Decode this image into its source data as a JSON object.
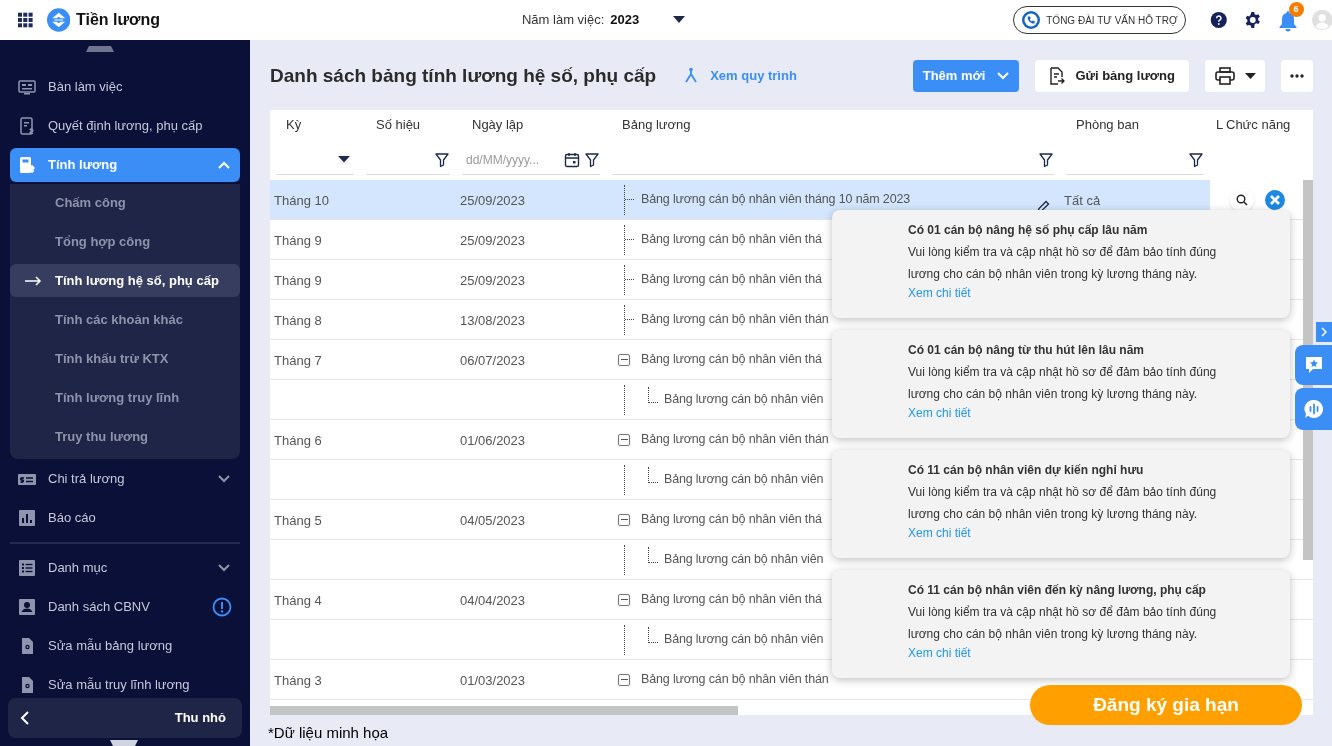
{
  "app": {
    "title": "Tiền lương"
  },
  "working_year": {
    "label": "Năm làm việc:",
    "value": "2023"
  },
  "support": {
    "label": "TỔNG ĐÀI TƯ VẤN HỖ TRỢ"
  },
  "notifications": {
    "count": "6"
  },
  "sidebar": {
    "sections": [
      {
        "items": [
          {
            "label": "Bàn làm việc",
            "selected": false
          },
          {
            "label": "Quyết định lương, phụ cấp",
            "selected": false
          },
          {
            "label": "Tính lương",
            "selected": true,
            "expanded": true,
            "children": [
              {
                "label": "Chấm công",
                "selected": false
              },
              {
                "label": "Tổng hợp công",
                "selected": false
              },
              {
                "label": "Tính lương hệ số, phụ cấp",
                "selected": true
              },
              {
                "label": "Tính các khoản khác",
                "selected": false
              },
              {
                "label": "Tính khấu trừ KTX",
                "selected": false
              },
              {
                "label": "Tính lương truy lĩnh",
                "selected": false
              },
              {
                "label": "Truy thu lương",
                "selected": false
              }
            ]
          },
          {
            "label": "Chi trả lương",
            "selected": false,
            "expanded": false
          },
          {
            "label": "Báo cáo",
            "selected": false
          }
        ]
      },
      {
        "items": [
          {
            "label": "Danh mục",
            "selected": false,
            "expanded": false
          },
          {
            "label": "Danh sách CBNV",
            "selected": false,
            "warning": true
          },
          {
            "label": "Sửa mẫu bảng lương",
            "selected": false
          },
          {
            "label": "Sửa mẫu truy lĩnh lương",
            "selected": false
          }
        ]
      }
    ],
    "collapse_label": "Thu nhỏ"
  },
  "page": {
    "title": "Danh sách bảng tính lương hệ số, phụ cấp",
    "process_link": "Xem quy trình",
    "add_button": "Thêm mới",
    "send_button": "Gửi bảng lương"
  },
  "table": {
    "columns": [
      {
        "label": "Kỳ",
        "kind": "dropdown"
      },
      {
        "label": "Số hiệu",
        "kind": "text"
      },
      {
        "label": "Ngày lập",
        "kind": "date",
        "placeholder": "dd/MM/yyyy..."
      },
      {
        "label": "Bảng lương",
        "kind": "text"
      },
      {
        "label": "Phòng ban",
        "kind": "text"
      },
      {
        "label": "L",
        "kind": "plain"
      },
      {
        "label": "Chức năng",
        "kind": "plain"
      }
    ],
    "rows": [
      {
        "kind": "leaf",
        "selected": true,
        "period": "Tháng 10",
        "date": "25/09/2023",
        "name": "Bảng lương cán bộ nhân viên tháng 10 năm 2023",
        "department": "Tất cả"
      },
      {
        "kind": "leaf",
        "selected": false,
        "period": "Tháng 9",
        "date": "25/09/2023",
        "name": "Bảng lương cán bộ nhân viên thá"
      },
      {
        "kind": "leaf",
        "selected": false,
        "period": "Tháng 9",
        "date": "25/09/2023",
        "name": "Bảng lương cán bộ nhân viên thá"
      },
      {
        "kind": "leaf",
        "selected": false,
        "period": "Tháng 8",
        "date": "13/08/2023",
        "name": "Bảng lương cán bộ nhân viên thán"
      },
      {
        "kind": "group",
        "expanded": true,
        "selected": false,
        "period": "Tháng 7",
        "date": "06/07/2023",
        "name": "Bảng lương cán bộ nhân viên thá"
      },
      {
        "kind": "child",
        "selected": false,
        "name": "Bảng lương cán bộ nhân viên"
      },
      {
        "kind": "group",
        "expanded": true,
        "selected": false,
        "period": "Tháng 6",
        "date": "01/06/2023",
        "name": "Bảng lương cán bộ nhân viên thán"
      },
      {
        "kind": "child",
        "selected": false,
        "name": "Bảng lương cán bộ nhân viên"
      },
      {
        "kind": "group",
        "expanded": true,
        "selected": false,
        "period": "Tháng 5",
        "date": "04/05/2023",
        "name": "Bảng lương cán bộ nhân viên thá"
      },
      {
        "kind": "child",
        "selected": false,
        "name": "Bảng lương cán bộ nhân viên"
      },
      {
        "kind": "group",
        "expanded": true,
        "selected": false,
        "period": "Tháng 4",
        "date": "04/04/2023",
        "name": "Bảng lương cán bộ nhân viên thá"
      },
      {
        "kind": "child",
        "selected": false,
        "name": "Bảng lương cán bộ nhân viên"
      },
      {
        "kind": "group",
        "expanded": true,
        "selected": false,
        "period": "Tháng 3",
        "date": "01/03/2023",
        "name": "Bảng lương cán bộ nhân viên thán"
      }
    ]
  },
  "toasts": [
    {
      "title": "Có 01 cán bộ nâng hệ số phụ cấp lâu năm",
      "message": "Vui lòng kiểm tra và cập nhật hồ sơ để đảm bảo tính đúng lương cho cán bộ nhân viên trong kỳ lương tháng này.",
      "link": "Xem chi tiết"
    },
    {
      "title": "Có 01 cán bộ nâng từ thu hút lên lâu năm",
      "message": "Vui lòng kiểm tra và cập nhật hồ sơ để đảm bảo tính đúng lương cho cán bộ nhân viên trong kỳ lương tháng này.",
      "link": "Xem chi tiết"
    },
    {
      "title": "Có 11 cán bộ nhân viên dự kiến nghỉ hưu",
      "message": "Vui lòng kiểm tra và cập nhật hồ sơ để đảm bảo tính đúng lương cho cán bộ nhân viên trong kỳ lương tháng này.",
      "link": "Xem chi tiết"
    },
    {
      "title": "Có 11 cán bộ nhân viên đến kỳ nâng lương, phụ cấp",
      "message": "Vui lòng kiểm tra và cập nhật hồ sơ để đảm bảo tính đúng lương cho cán bộ nhân viên trong kỳ lương tháng này.",
      "link": "Xem chi tiết"
    }
  ],
  "renew_button": "Đăng ký gia hạn",
  "footnote": "*Dữ liệu minh họa"
}
